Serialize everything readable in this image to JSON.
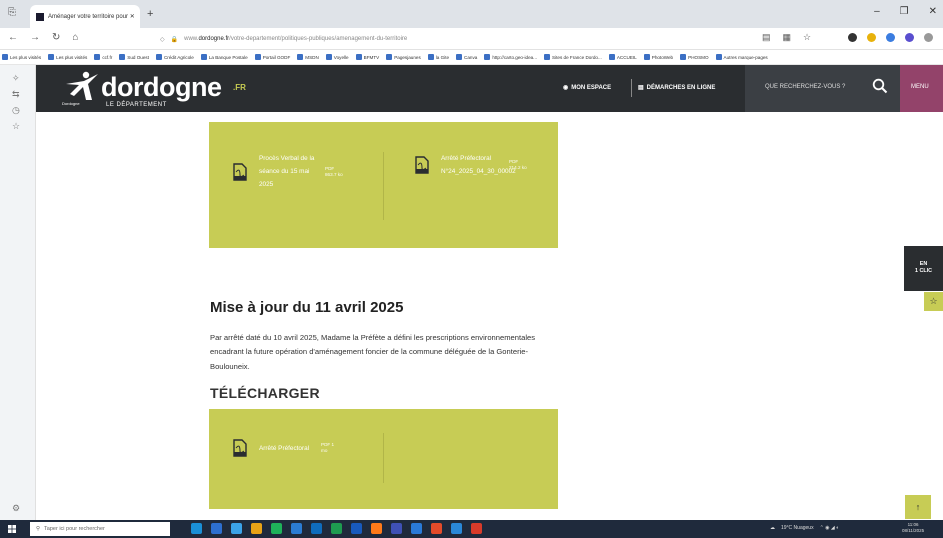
{
  "browser": {
    "tab_title": "Aménager votre territoire pour ✕",
    "new_tab": "+",
    "url_prefix": "www.",
    "url_domain": "dordogne.fr",
    "url_path": "/votre-departement/politiques-publiques/amenagement-du-territoire",
    "bookmarks": [
      "Les plus visités",
      "Les plus visités",
      "ccf.fr",
      "Sud Ouest",
      "Crédit Agricole",
      "La Banque Postale",
      "Portail GODF",
      "MSDN",
      "Voyelle",
      "BFMTV",
      "Pagesjaunes",
      "la Gite",
      "Canva",
      "http://carto.geo-idea...",
      "Sites de France Dordo...",
      "ACCUEIL",
      "PhotoWeb",
      "PHOSMO",
      "Autres marque-pages"
    ]
  },
  "site": {
    "logo_text": "dordogne",
    "logo_suffix": ".FR",
    "logo_subtitle": "LE DÉPARTEMENT",
    "logo_tag": "Dordogne",
    "nav_espace": "MON ESPACE",
    "nav_demarches": "DÉMARCHES EN LIGNE",
    "search_label": "QUE RECHERCHEZ-VOUS ?",
    "menu_label": "MENU"
  },
  "box1": {
    "doc1_title": "Procès Verbal de la séance du 15 mai 2025",
    "doc1_meta": "PDF 863.7 ko",
    "doc2_title": "Arrêté Préfectoral N°24_2025_04_30_00002",
    "doc2_meta": "PDF 214.2 ko"
  },
  "update": {
    "heading": "Mise à jour du 11 avril 2025",
    "paragraph": "Par arrêté daté du 10 avril 2025, Madame la Préfète a défini les prescriptions environnementales encadrant la future opération d'aménagement foncier de la commune déléguée de la Gonterie-Boulouneix.",
    "download_heading": "TÉLÉCHARGER"
  },
  "box2": {
    "doc1_title": "Arrêté Préfectoral",
    "doc1_meta": "PDF 1 mo"
  },
  "floating": {
    "enclic_line1": "EN",
    "enclic_line2": "1 CLIC",
    "totop": "↑"
  },
  "taskbar": {
    "search_placeholder": "Taper ici pour rechercher",
    "weather": "19°C Nuageux",
    "time": "11:06",
    "date": "08/11/2025"
  },
  "colors": {
    "accent_green": "#c7cc55",
    "header_dark": "#2a2d30",
    "menu_purple": "#93436a"
  }
}
